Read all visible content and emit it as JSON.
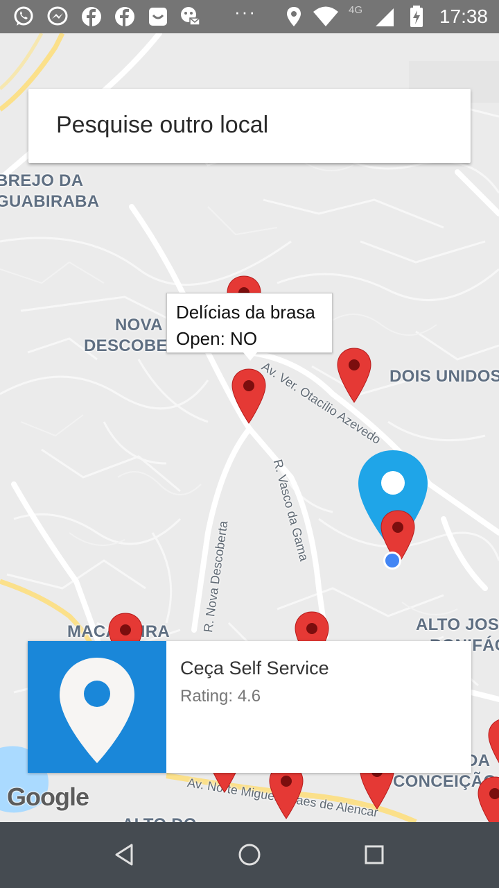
{
  "status_bar": {
    "time": "17:38",
    "network": "4G",
    "more": "···",
    "icons": [
      "whatsapp-icon",
      "messenger-icon",
      "facebook-icon",
      "facebook-icon",
      "inbox-icon",
      "emoji-mail-icon",
      "location-icon",
      "wifi-icon",
      "signal-icon",
      "battery-charging-icon"
    ]
  },
  "search": {
    "placeholder": "Pesquise outro local"
  },
  "map": {
    "areas": {
      "brejo": "BREJO DA\nGUABIRABA",
      "nova": "NOVA",
      "descoberta": "DESCOBERTA",
      "dois_unidos": "DOIS UNIDOS",
      "alto_jose": "ALTO JOSÉ",
      "bonifacio": "BONIFÁCIO",
      "macaxeira": "MACAXEIRA",
      "conceicao_da": "DA",
      "conceicao": "CONCEIÇÃO",
      "alto_do": "ALTO DO"
    },
    "streets": {
      "otacilio": "Av. Ver. Otacílio Azevedo",
      "vasco": "R. Vasco da Gama",
      "nova_descoberta": "R. Nova Descoberta",
      "norte": "Av. Norte Miguel Arraes de Alencar"
    },
    "marker_color": "#e53935",
    "user_location_color": "#4285f4",
    "selected_marker_color": "#1fa5e8"
  },
  "info_window": {
    "title": "Delícias da brasa",
    "status": "Open: NO"
  },
  "place_card": {
    "name": "Ceça Self Service",
    "rating": "Rating: 4.6",
    "icon": "location-pin-icon",
    "color": "#1a87d9"
  },
  "google_logo": "Google",
  "nav": {
    "back": "back-icon",
    "home": "home-icon",
    "recents": "recents-icon"
  }
}
